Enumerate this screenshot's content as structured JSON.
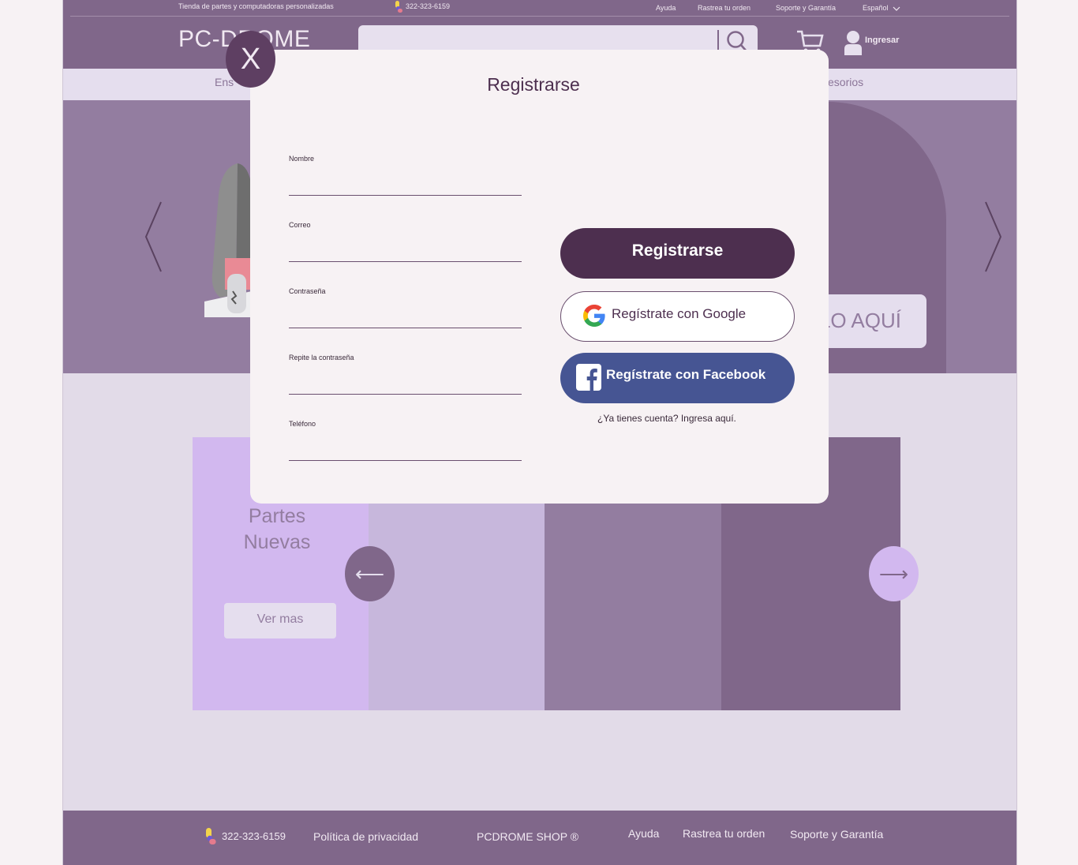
{
  "header": {
    "tagline": "Tienda de partes y computadoras personalizadas",
    "phone": "322-323-6159",
    "top_links": [
      "Ayuda",
      "Rastrea tu orden",
      "Soporte y Garantía"
    ],
    "language": "Español",
    "logo": "PC-DROME",
    "search_placeholder": "",
    "login_label": "Ingresar",
    "nav_left": "Ens",
    "nav_right": "esorios"
  },
  "hero": {
    "cta_label": "LO AQUÍ"
  },
  "tiles": [
    {
      "title": "Partes\nNuevas",
      "button": "Ver mas",
      "color": "#d2b8ef"
    },
    {
      "color": "#c7b7dc"
    },
    {
      "color": "#937da0"
    },
    {
      "color": "#80678a"
    }
  ],
  "carousel": {
    "prev_icon": "arrow-left-icon",
    "next_icon": "arrow-right-icon",
    "prev_glyph": "⟵",
    "next_glyph": "⟶"
  },
  "footer": {
    "phone": "322-323-6159",
    "privacy": "Política  de privacidad",
    "brand": "PCDROME SHOP ®",
    "links": [
      "Ayuda",
      "Rastrea tu orden",
      "Soporte y Garantía"
    ]
  },
  "modal": {
    "close_label": "X",
    "title": "Registrarse",
    "fields": [
      {
        "label": "Nombre",
        "value": ""
      },
      {
        "label": "Correo",
        "value": ""
      },
      {
        "label": "Contraseña",
        "value": ""
      },
      {
        "label": "Repite la contraseña",
        "value": ""
      },
      {
        "label": "Teléfono",
        "value": ""
      }
    ],
    "register_button": "Registrarse",
    "google_button": "Regístrate con Google",
    "facebook_button": "Regístrate con Facebook",
    "login_link": "¿Ya tienes cuenta? Ingresa aquí."
  },
  "colors": {
    "primary": "#80678a",
    "accent": "#4d2f4f",
    "facebook": "#465593",
    "overlay_bg": "#f7f2f4"
  }
}
